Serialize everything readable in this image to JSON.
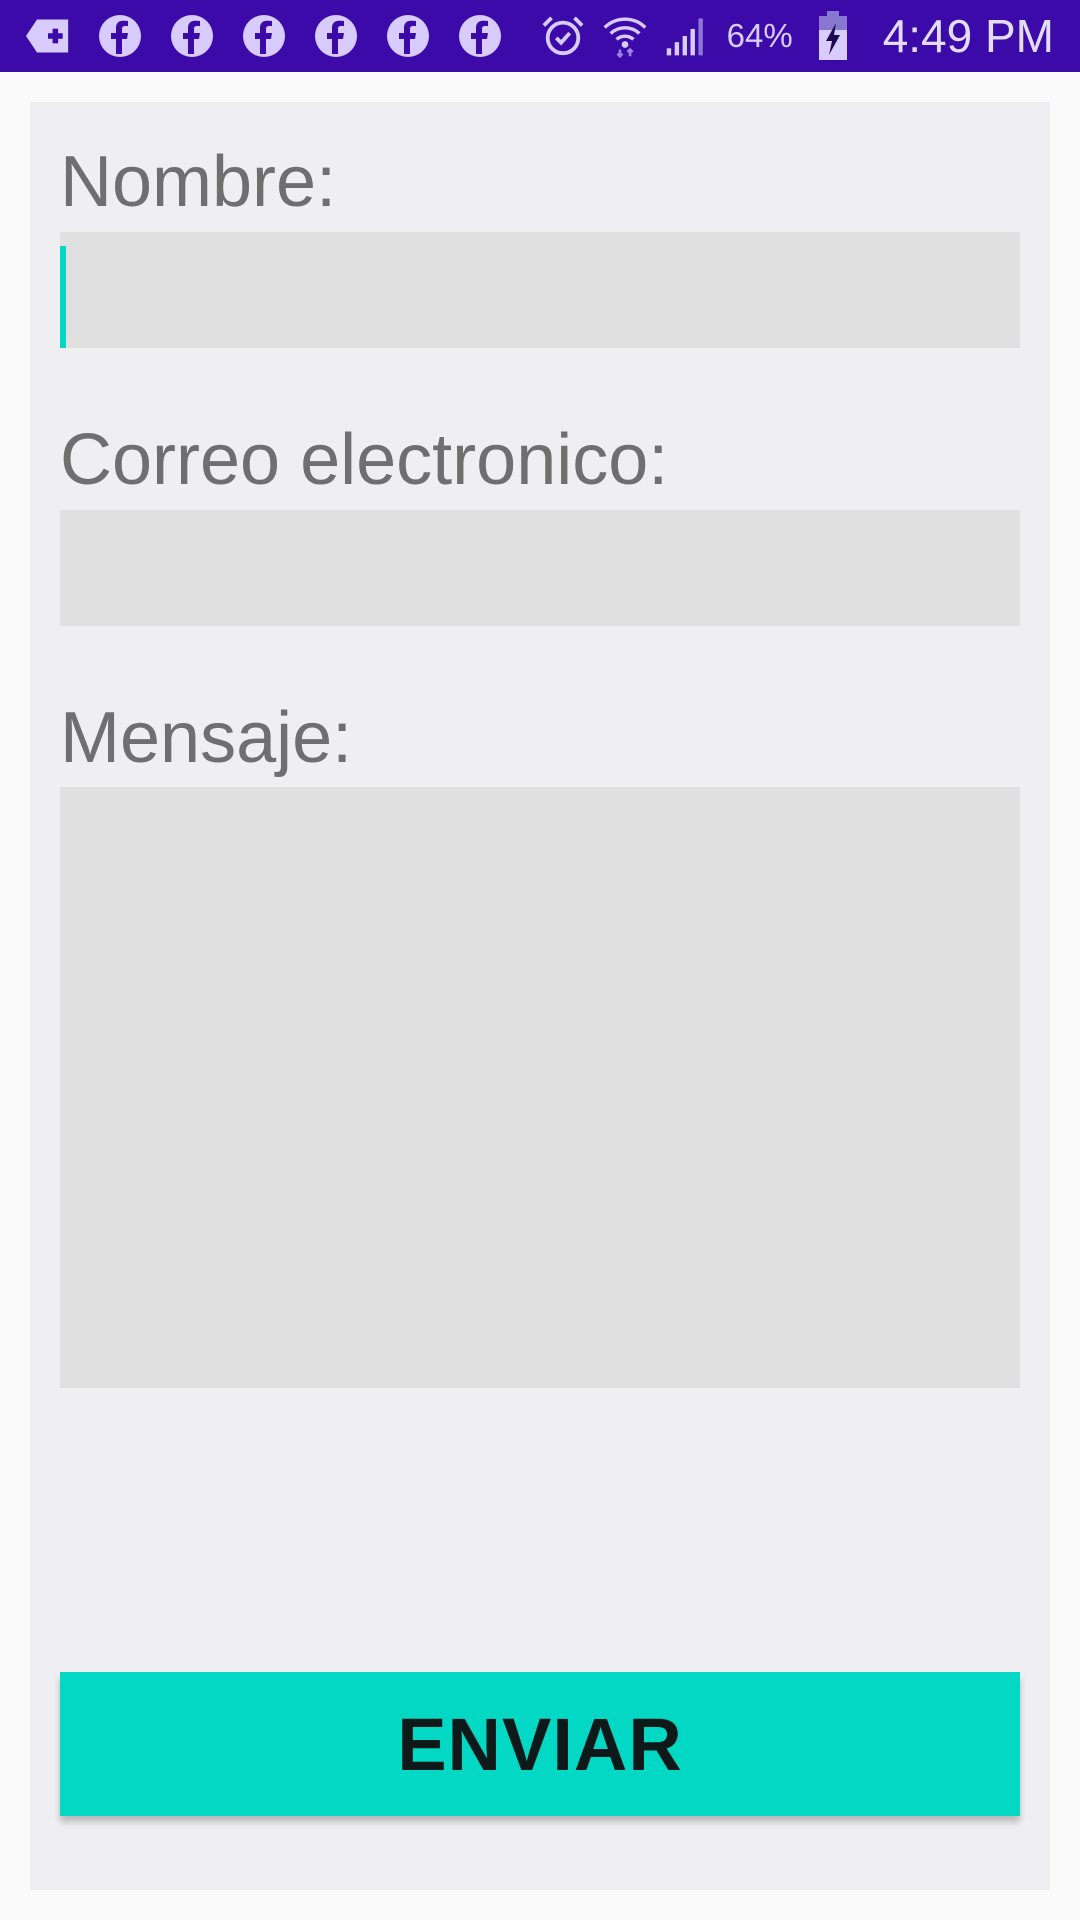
{
  "status_bar": {
    "notification_icons": [
      "add-notification-icon",
      "facebook-icon",
      "facebook-icon",
      "facebook-icon",
      "facebook-icon",
      "facebook-icon",
      "facebook-icon"
    ],
    "system_icons": [
      "alarm-icon",
      "wifi-icon",
      "signal-icon",
      "battery-charging-icon"
    ],
    "battery_percent": "64%",
    "time": "4:49 PM",
    "background_color": "#3c0aa8"
  },
  "form": {
    "name_label": "Nombre:",
    "name_value": "",
    "email_label": "Correo electronico:",
    "email_value": "",
    "message_label": "Mensaje:",
    "message_value": "",
    "send_label": "ENVIAR"
  },
  "colors": {
    "accent": "#03d8c4",
    "field_background": "#e0e0e0",
    "card_background": "#efeef0",
    "label_text": "#6f6f6f"
  }
}
